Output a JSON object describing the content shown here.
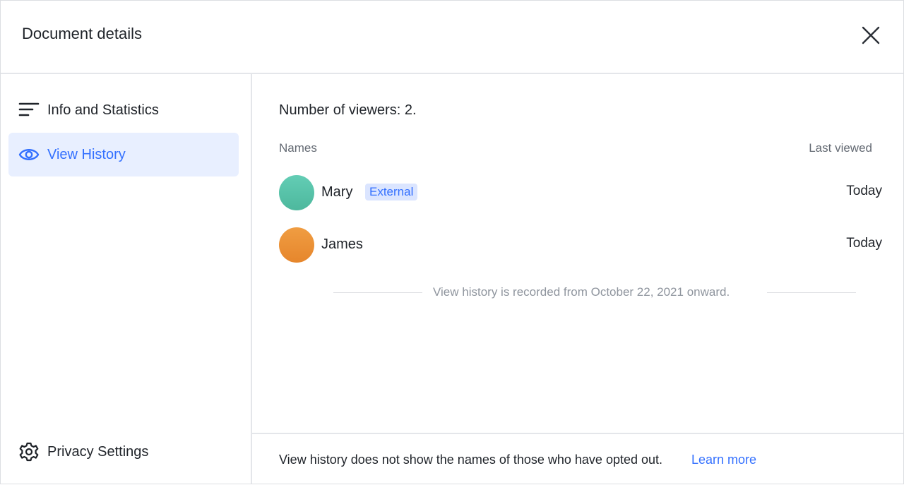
{
  "dialog": {
    "title": "Document details"
  },
  "sidebar": {
    "items": [
      {
        "label": "Info and Statistics",
        "icon": "list-lines-icon",
        "active": false
      },
      {
        "label": "View History",
        "icon": "eye-icon",
        "active": true
      }
    ],
    "bottom_item": {
      "label": "Privacy Settings",
      "icon": "gear-icon"
    }
  },
  "main": {
    "viewer_count_text": "Number of viewers: 2.",
    "columns": {
      "names": "Names",
      "last_viewed": "Last viewed"
    },
    "viewers": [
      {
        "name": "Mary",
        "badge": "External",
        "last_viewed": "Today",
        "avatar_color": "#5cc6ae"
      },
      {
        "name": "James",
        "badge": "",
        "last_viewed": "Today",
        "avatar_color": "#eb9336"
      }
    ],
    "history_note": "View history is recorded from October 22, 2021 onward."
  },
  "footer": {
    "text": "View history does not show the names of those who have opted out.",
    "link": "Learn more"
  },
  "colors": {
    "accent": "#3370ff",
    "active_bg": "#e8efff",
    "badge_bg": "#dbe5ff"
  }
}
